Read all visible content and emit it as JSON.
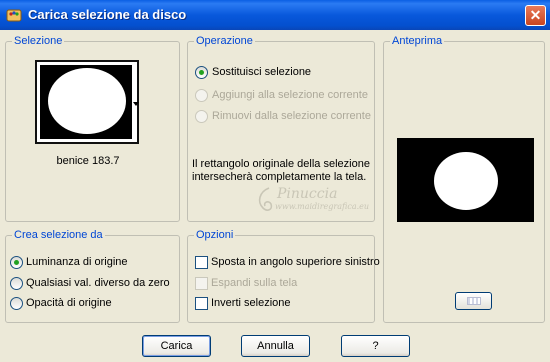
{
  "window": {
    "title": "Carica selezione da disco",
    "close_glyph": "✕"
  },
  "selezione": {
    "label": "Selezione",
    "selection_name": "benice 183.7"
  },
  "operazione": {
    "label": "Operazione",
    "options": [
      {
        "label": "Sostituisci selezione",
        "selected": true,
        "enabled": true
      },
      {
        "label": "Aggiungi alla selezione corrente",
        "selected": false,
        "enabled": false
      },
      {
        "label": "Rimuovi dalla selezione corrente",
        "selected": false,
        "enabled": false
      }
    ],
    "info_text": "Il rettangolo originale della selezione intersecherà completamente la tela."
  },
  "anteprima": {
    "label": "Anteprima"
  },
  "crea_selezione": {
    "label": "Crea selezione da",
    "options": [
      {
        "label": "Luminanza di origine",
        "selected": true
      },
      {
        "label": "Qualsiasi val. diverso da zero",
        "selected": false
      },
      {
        "label": "Opacità di origine",
        "selected": false
      }
    ]
  },
  "opzioni": {
    "label": "Opzioni",
    "items": [
      {
        "label": "Sposta in angolo superiore sinistro",
        "checked": false,
        "enabled": true
      },
      {
        "label": "Espandi sulla tela",
        "checked": false,
        "enabled": false
      },
      {
        "label": "Inverti selezione",
        "checked": false,
        "enabled": true
      }
    ]
  },
  "watermark": {
    "name": "Pinuccia",
    "site": "www.maidiregrafica.eu"
  },
  "buttons": {
    "ok": "Carica",
    "cancel": "Annulla",
    "help": "?"
  },
  "colors": {
    "titlebar": "#0858DC",
    "group_label": "#0046D5",
    "radio_dot": "#21A121",
    "dialog_bg": "#ECE9D8"
  },
  "icons": {
    "app": "app-icon",
    "close": "close-icon",
    "preview_toggle": "preview-pattern-icon"
  }
}
